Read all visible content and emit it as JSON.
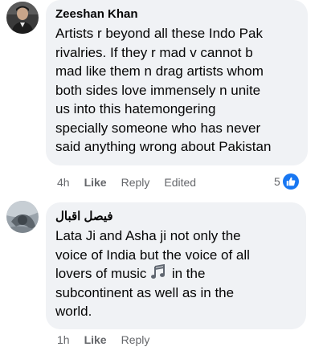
{
  "comments": [
    {
      "author": "Zeeshan Khan",
      "text_lines": [
        "Artists r beyond all these Indo Pak",
        "rivalries. If they r mad v cannot b",
        "mad like them n drag artists whom",
        "both sides love immensely n unite",
        "us into this hatemongering",
        "specially someone who has never",
        "said anything wrong about Pakistan"
      ],
      "time": "4h",
      "like_label": "Like",
      "reply_label": "Reply",
      "edited_label": "Edited",
      "reaction_count": "5",
      "reaction_icon": "like-icon"
    },
    {
      "author": "فيصل اقبال",
      "text_lines": [
        "Lata Ji and Asha ji not only the",
        "voice of India but the voice of all",
        "lovers of music",
        "in the",
        "subcontinent as well as in the",
        "world."
      ],
      "emoji": "music-notes-icon",
      "time": "1h",
      "like_label": "Like",
      "reply_label": "Reply"
    }
  ],
  "colors": {
    "bubble": "#f0f2f5",
    "text": "#050505",
    "meta": "#65676b",
    "like_blue": "#1877f2"
  }
}
